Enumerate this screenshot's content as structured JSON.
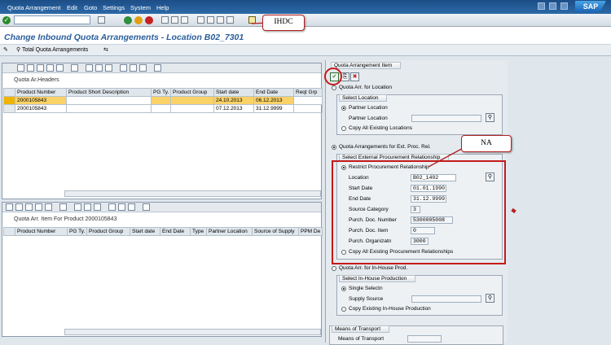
{
  "menu": [
    "Quota Arrangement",
    "Edit",
    "Goto",
    "Settings",
    "System",
    "Help"
  ],
  "sap_logo": "SAP",
  "title": "Change Inbound Quota Arrangements - Location B02_7301",
  "appbar": {
    "button": "Total Quota Arrangements"
  },
  "callouts": {
    "top": "IHDC",
    "right": "NA"
  },
  "grid1": {
    "title": "Quota Ar.Headers",
    "columns": [
      "Product Number",
      "Product Short Description",
      "PG Ty.",
      "Product Group",
      "Start date",
      "End Date",
      "Reqt Grp"
    ],
    "rows": [
      [
        "2000105843",
        "",
        "",
        "",
        "24.10.2013",
        "06.12.2013",
        ""
      ],
      [
        "2000105843",
        "",
        "",
        "",
        "07.12.2013",
        "31.12.9999",
        ""
      ]
    ]
  },
  "grid2": {
    "title": "Quota Arr. Item For Product 2000105843",
    "columns": [
      "Product Number",
      "PG Ty.",
      "Product Group",
      "Start date",
      "End Date",
      "Type",
      "Partner Location",
      "Source of Supply",
      "PPM De"
    ]
  },
  "item": {
    "title": "Quota Arrangement Item",
    "loc_radio": "Quota Arr. for Location",
    "select_location": "Select Location",
    "partner_location_radio": "Partner Location",
    "partner_location_label": "Partner Location",
    "copy_all_locations": "Copy All Existing Locations",
    "ext_radio": "Quota Arrangements for Ext. Proc. Rel.",
    "select_ext": "Select External Procurement Relationship",
    "restrict": "Restrict Procurement Relationship",
    "fields": [
      {
        "label": "Location",
        "value": "B02_1402"
      },
      {
        "label": "Start Date",
        "value": "01.01.1990"
      },
      {
        "label": "End Date",
        "value": "31.12.9999"
      },
      {
        "label": "Source Category",
        "value": "3"
      },
      {
        "label": "Purch. Doc. Number",
        "value": "5300005008"
      },
      {
        "label": "Purch. Doc. Item",
        "value": "0"
      },
      {
        "label": "Purch. Organizatn",
        "value": "3000"
      }
    ],
    "copy_all_ext": "Copy All Existing Procurement Relationships",
    "inhouse_radio": "Quota Arr. for In-House Prod.",
    "select_inhouse": "Select In-House Production",
    "single_selectn": "Single Selectn",
    "supply_source": "Supply Source",
    "copy_inhouse": "Copy Existing In-House Production",
    "means_group": "Means of Transport",
    "means_label": "Means of Transport"
  }
}
